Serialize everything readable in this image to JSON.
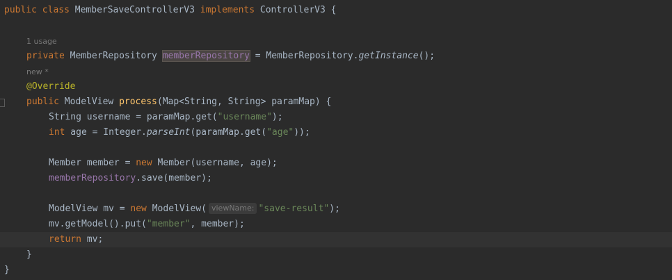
{
  "editor": {
    "class_decl": {
      "kw_public": "public",
      "kw_class": "class",
      "class_name": "MemberSaveControllerV3",
      "kw_implements": "implements",
      "interface": "ControllerV3",
      "brace": " {"
    },
    "hints": {
      "usages": "1 usage",
      "new_marker": "new *"
    },
    "field_decl": {
      "kw_private": "private",
      "type": "MemberRepository",
      "name": "memberRepository",
      "assign": " = ",
      "call_owner": "MemberRepository.",
      "call_method": "getInstance",
      "call_end": "();"
    },
    "annotation": "@Override",
    "method_decl": {
      "kw_public": "public",
      "return_type": "ModelView",
      "name": "process",
      "params": "(Map<String, String> paramMap) {"
    },
    "line_username": {
      "prefix": "String username = paramMap.get(",
      "str": "\"username\"",
      "suffix": ");"
    },
    "line_age": {
      "kw_int": "int",
      "mid": " age = Integer.",
      "method": "parseInt",
      "mid2": "(paramMap.get(",
      "str": "\"age\"",
      "suffix": "));"
    },
    "line_member": {
      "prefix": "Member member = ",
      "kw_new": "new",
      "suffix": " Member(username, age);"
    },
    "line_save": {
      "field": "memberRepository",
      "suffix": ".save(member);"
    },
    "line_mv": {
      "prefix": "ModelView mv = ",
      "kw_new": "new",
      "mid": " ModelView(",
      "param_hint": "viewName:",
      "str": "\"save-result\"",
      "suffix": ");"
    },
    "line_put": {
      "prefix": "mv.getModel().put(",
      "str": "\"member\"",
      "suffix": ", member);"
    },
    "line_return": {
      "kw_return": "return",
      "suffix": " mv;"
    },
    "close_method": "}",
    "close_class": "}"
  }
}
